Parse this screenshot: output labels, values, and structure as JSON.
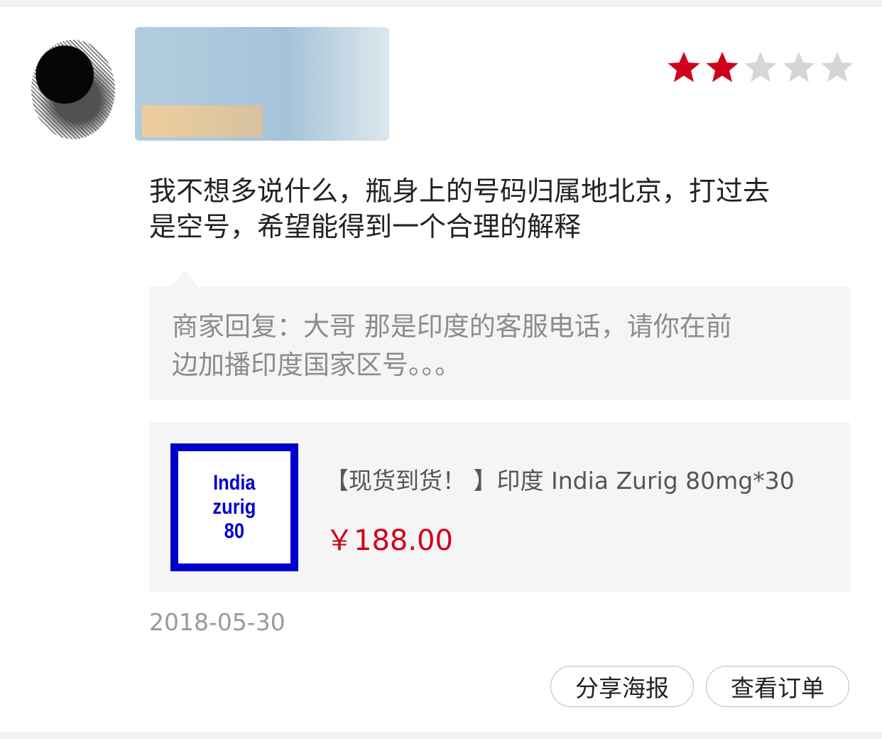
{
  "review": {
    "rating": 2,
    "rating_max": 5,
    "star_filled_color": "#d0021b",
    "star_empty_color": "#d6d6d6",
    "text": "我不想多说什么，瓶身上的号码归属地北京，打过去\n是空号，希望能得到一个合理的解释",
    "date": "2018-05-30"
  },
  "merchant_reply": {
    "text": "商家回复：大哥 那是印度的客服电话，请你在前\n边加播印度国家区号。。。"
  },
  "product": {
    "thumbnail_text": "India\nzurig\n80",
    "title": "【现货到货！ 】印度 India Zurig 80mg*30",
    "price": "￥188.00",
    "price_color": "#d0021b"
  },
  "actions": {
    "share_label": "分享海报",
    "order_label": "查看订单"
  }
}
